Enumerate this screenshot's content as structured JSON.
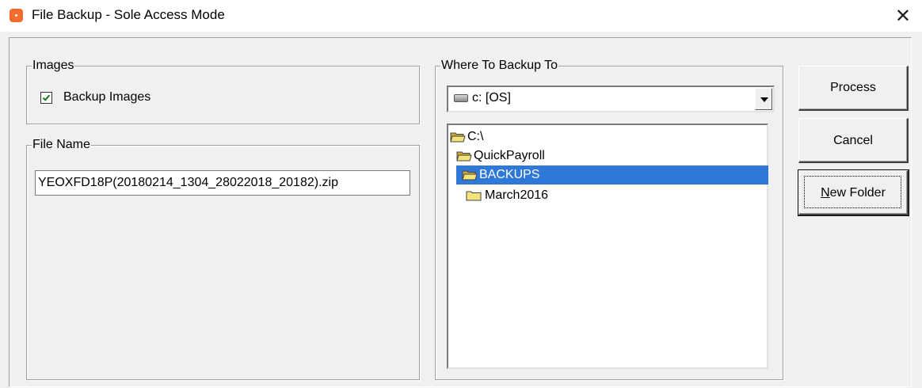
{
  "window": {
    "title": "File Backup - Sole Access Mode",
    "close_glyph": "✕"
  },
  "images_group": {
    "legend": "Images",
    "backup_images_label": "Backup Images",
    "backup_images_checked": true
  },
  "filename_group": {
    "legend": "File Name",
    "value": "YEOXFD18P(20180214_1304_28022018_20182).zip"
  },
  "backup_group": {
    "legend": "Where To Backup To",
    "drive": "c: [OS]",
    "tree": [
      {
        "label": "C:\\",
        "state": "open",
        "selected": false
      },
      {
        "label": "QuickPayroll",
        "state": "open",
        "selected": false
      },
      {
        "label": "BACKUPS",
        "state": "open",
        "selected": true
      },
      {
        "label": "March2016",
        "state": "closed",
        "selected": false
      }
    ]
  },
  "buttons": {
    "process": "Process",
    "cancel": "Cancel",
    "new_folder_mnemonic": "N",
    "new_folder_rest": "ew Folder"
  },
  "colors": {
    "selection": "#3078d8",
    "window_bg": "#f0f0f0",
    "app_icon": "#f26b2a",
    "checkmark": "#1c7a1c"
  }
}
